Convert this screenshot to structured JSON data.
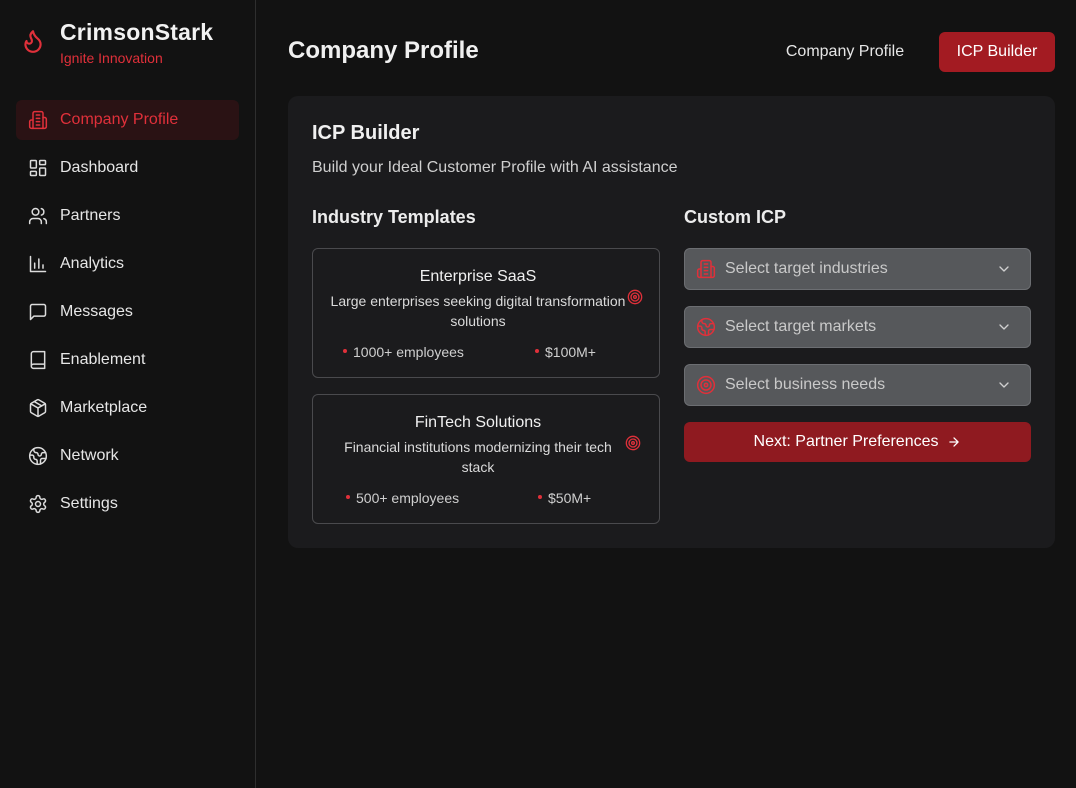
{
  "brand": {
    "name": "CrimsonStark",
    "tagline": "Ignite Innovation",
    "logo_icon": "flame-icon"
  },
  "sidebar": {
    "items": [
      {
        "label": "Company Profile",
        "icon": "building-icon",
        "active": true
      },
      {
        "label": "Dashboard",
        "icon": "dashboard-icon",
        "active": false
      },
      {
        "label": "Partners",
        "icon": "users-icon",
        "active": false
      },
      {
        "label": "Analytics",
        "icon": "bar-chart-icon",
        "active": false
      },
      {
        "label": "Messages",
        "icon": "message-icon",
        "active": false
      },
      {
        "label": "Enablement",
        "icon": "book-icon",
        "active": false
      },
      {
        "label": "Marketplace",
        "icon": "package-icon",
        "active": false
      },
      {
        "label": "Network",
        "icon": "globe-icon",
        "active": false
      },
      {
        "label": "Settings",
        "icon": "gear-icon",
        "active": false
      }
    ]
  },
  "header": {
    "title": "Company Profile",
    "tabs": [
      {
        "label": "Company Profile",
        "active": false
      },
      {
        "label": "ICP Builder",
        "active": true
      }
    ]
  },
  "icp": {
    "title": "ICP Builder",
    "subtitle": "Build your Ideal Customer Profile with AI assistance",
    "templates_title": "Industry Templates",
    "custom_title": "Custom ICP",
    "templates": [
      {
        "name": "Enterprise SaaS",
        "description": "Large enterprises seeking digital transformation solutions",
        "employees": "1000+ employees",
        "revenue": "$100M+"
      },
      {
        "name": "FinTech Solutions",
        "description": "Financial institutions modernizing their tech stack",
        "employees": "500+ employees",
        "revenue": "$50M+"
      }
    ],
    "selects": [
      {
        "placeholder": "Select target industries",
        "icon": "building-icon"
      },
      {
        "placeholder": "Select target markets",
        "icon": "globe-icon"
      },
      {
        "placeholder": "Select business needs",
        "icon": "target-icon"
      }
    ],
    "next_label": "Next: Partner Preferences"
  },
  "colors": {
    "accent": "#e0303a",
    "button": "#a31b22",
    "background": "#121212",
    "card": "#1b1b1d"
  }
}
